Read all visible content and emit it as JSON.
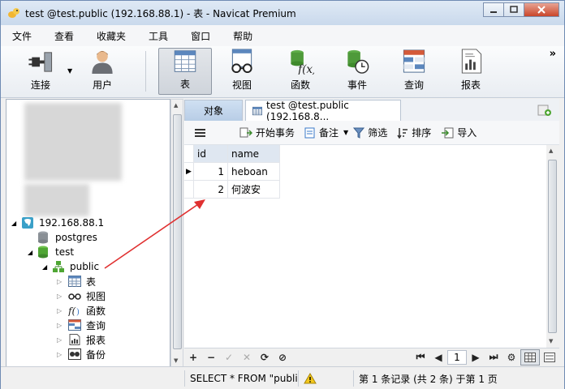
{
  "window": {
    "title": "test @test.public (192.168.88.1) - 表 - Navicat Premium",
    "controls": [
      "minimize",
      "maximize",
      "close"
    ]
  },
  "menu": [
    "文件",
    "查看",
    "收藏夹",
    "工具",
    "窗口",
    "帮助"
  ],
  "toolbar": {
    "items": [
      {
        "label": "连接",
        "icon": "plug-icon"
      },
      {
        "label": "用户",
        "icon": "user-icon"
      },
      {
        "label": "表",
        "icon": "table-icon",
        "active": true
      },
      {
        "label": "视图",
        "icon": "view-glasses-icon"
      },
      {
        "label": "函数",
        "icon": "function-icon"
      },
      {
        "label": "事件",
        "icon": "event-clock-icon"
      },
      {
        "label": "查询",
        "icon": "query-icon"
      },
      {
        "label": "报表",
        "icon": "report-icon"
      }
    ],
    "more": "»"
  },
  "tree": {
    "connection": "192.168.88.1",
    "databases": [
      "postgres",
      "test"
    ],
    "schema": "public",
    "schema_children": [
      {
        "label": "表",
        "icon": "table-icon"
      },
      {
        "label": "视图",
        "icon": "view-glasses-icon"
      },
      {
        "label": "函数",
        "icon": "function-icon"
      },
      {
        "label": "查询",
        "icon": "query-icon"
      },
      {
        "label": "报表",
        "icon": "report-icon"
      },
      {
        "label": "备份",
        "icon": "backup-icon"
      }
    ]
  },
  "tabs": {
    "objects": "对象",
    "table": "test @test.public (192.168.8..."
  },
  "grid_toolbar": {
    "menu_icon": "hamburger-icon",
    "begin_transaction": "开始事务",
    "note": "备注",
    "filter": "筛选",
    "sort": "排序",
    "import": "导入"
  },
  "table": {
    "columns": [
      "id",
      "name"
    ],
    "rows": [
      {
        "id": "1",
        "name": "heboan"
      },
      {
        "id": "2",
        "name": "何波安"
      }
    ]
  },
  "pagination": {
    "page": "1"
  },
  "status": {
    "sql": "SELECT * FROM \"public",
    "records": "第 1 条记录 (共 2 条) 于第 1 页"
  },
  "colors": {
    "annotation_arrow": "#e03030",
    "accent": "#3c78c8"
  }
}
